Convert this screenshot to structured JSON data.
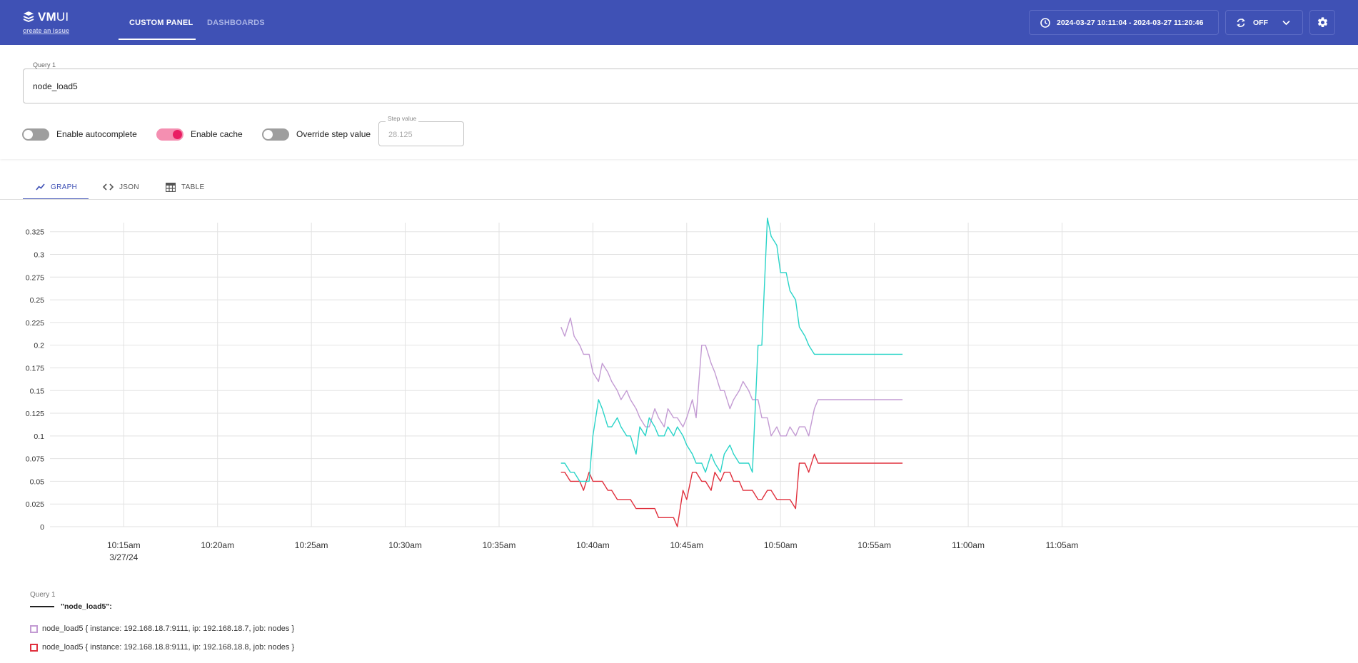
{
  "header": {
    "logo_main": "VM",
    "logo_suffix": "UI",
    "create_issue": "create an issue",
    "tabs": [
      {
        "label": "CUSTOM PANEL",
        "active": true
      },
      {
        "label": "DASHBOARDS",
        "active": false
      }
    ],
    "time_range": "2024-03-27 10:11:04 - 2024-03-27 11:20:46",
    "refresh_label": "OFF",
    "icons": {
      "time": "clock-icon",
      "refresh": "refresh-icon",
      "dropdown": "chevron-down-icon",
      "settings": "gear-icon"
    },
    "color": "#3f51b5"
  },
  "query": {
    "label": "Query 1",
    "value": "node_load5"
  },
  "options": {
    "autocomplete": {
      "label": "Enable autocomplete",
      "enabled": false
    },
    "cache": {
      "label": "Enable cache",
      "enabled": true
    },
    "override_step": {
      "label": "Override step value",
      "enabled": false
    },
    "step": {
      "label": "Step value",
      "placeholder": "28.125"
    }
  },
  "result_tabs": [
    {
      "label": "GRAPH",
      "icon": "chart-line-icon",
      "active": true
    },
    {
      "label": "JSON",
      "icon": "code-icon",
      "active": false
    },
    {
      "label": "TABLE",
      "icon": "table-icon",
      "active": false
    }
  ],
  "chart_data": {
    "type": "line",
    "x_ticks": [
      "10:15am",
      "10:20am",
      "10:25am",
      "10:30am",
      "10:35am",
      "10:40am",
      "10:45am",
      "10:50am",
      "10:55am",
      "11:00am",
      "11:05am"
    ],
    "x_date_label": "3/27/24",
    "y_ticks": [
      "0",
      "0.025",
      "0.05",
      "0.075",
      "0.1",
      "0.125",
      "0.15",
      "0.175",
      "0.2",
      "0.225",
      "0.25",
      "0.275",
      "0.3",
      "0.325"
    ],
    "ylim": [
      0,
      0.335
    ],
    "grid": true,
    "x_range_minutes": [
      11.07,
      80.77
    ],
    "series": [
      {
        "name": "node_load5{ instance: 192.168.18.7:9111, ip: 192.168.18.7, job: nodes }",
        "color": "#c39bd3",
        "x": [
          38.3,
          38.5,
          38.8,
          39.0,
          39.3,
          39.5,
          39.8,
          40.0,
          40.3,
          40.5,
          40.8,
          41.0,
          41.3,
          41.5,
          41.8,
          42.0,
          42.3,
          42.5,
          42.8,
          43.0,
          43.3,
          43.5,
          43.8,
          44.0,
          44.3,
          44.5,
          44.8,
          45.0,
          45.3,
          45.5,
          45.8,
          46.0,
          46.3,
          46.5,
          46.8,
          47.0,
          47.3,
          47.5,
          47.8,
          48.0,
          48.3,
          48.5,
          48.8,
          49.0,
          49.3,
          49.5,
          49.8,
          50.0,
          50.3,
          50.5,
          50.8,
          51.0,
          51.3,
          51.5,
          51.8,
          52.0,
          52.3,
          52.5,
          52.8,
          53.0,
          53.3,
          53.5,
          53.8,
          54.0,
          54.3,
          54.5,
          54.8,
          55.0,
          55.3,
          55.5,
          55.8,
          56.0,
          56.3,
          56.5
        ],
        "y": [
          0.22,
          0.21,
          0.23,
          0.21,
          0.2,
          0.19,
          0.19,
          0.17,
          0.16,
          0.18,
          0.17,
          0.16,
          0.15,
          0.14,
          0.15,
          0.14,
          0.13,
          0.12,
          0.11,
          0.11,
          0.13,
          0.12,
          0.11,
          0.13,
          0.12,
          0.12,
          0.11,
          0.12,
          0.14,
          0.12,
          0.2,
          0.2,
          0.18,
          0.17,
          0.15,
          0.15,
          0.13,
          0.14,
          0.15,
          0.16,
          0.15,
          0.14,
          0.14,
          0.12,
          0.12,
          0.1,
          0.11,
          0.1,
          0.1,
          0.11,
          0.1,
          0.11,
          0.11,
          0.1,
          0.13,
          0.14,
          0.14,
          0.14,
          0.14,
          0.14,
          0.14,
          0.14,
          0.14,
          0.14,
          0.14,
          0.14,
          0.14,
          0.14,
          0.14,
          0.14,
          0.14,
          0.14,
          0.14,
          0.14
        ]
      },
      {
        "name": "node_load5{ instance: 192.168.18.8:9111, ip: 192.168.18.8, job: nodes }",
        "color": "#e0303d",
        "x": [
          38.3,
          38.5,
          38.8,
          39.0,
          39.3,
          39.5,
          39.8,
          40.0,
          40.3,
          40.5,
          40.8,
          41.0,
          41.3,
          41.5,
          41.8,
          42.0,
          42.3,
          42.5,
          42.8,
          43.0,
          43.3,
          43.5,
          43.8,
          44.0,
          44.3,
          44.5,
          44.8,
          45.0,
          45.3,
          45.5,
          45.8,
          46.0,
          46.3,
          46.5,
          46.8,
          47.0,
          47.3,
          47.5,
          47.8,
          48.0,
          48.3,
          48.5,
          48.8,
          49.0,
          49.3,
          49.5,
          49.8,
          50.0,
          50.3,
          50.5,
          50.8,
          51.0,
          51.3,
          51.5,
          51.8,
          52.0,
          52.3,
          52.5,
          52.8,
          53.0,
          53.3,
          53.5,
          53.8,
          54.0,
          54.3,
          54.5,
          54.8,
          55.0,
          55.3,
          55.5,
          55.8,
          56.0,
          56.3,
          56.5
        ],
        "y": [
          0.06,
          0.06,
          0.05,
          0.05,
          0.05,
          0.04,
          0.06,
          0.05,
          0.05,
          0.05,
          0.04,
          0.04,
          0.03,
          0.03,
          0.03,
          0.03,
          0.02,
          0.02,
          0.02,
          0.02,
          0.02,
          0.01,
          0.01,
          0.01,
          0.01,
          0.0,
          0.04,
          0.03,
          0.06,
          0.06,
          0.05,
          0.05,
          0.04,
          0.06,
          0.05,
          0.06,
          0.06,
          0.05,
          0.05,
          0.04,
          0.04,
          0.04,
          0.03,
          0.03,
          0.04,
          0.04,
          0.03,
          0.03,
          0.03,
          0.03,
          0.02,
          0.07,
          0.07,
          0.06,
          0.08,
          0.07,
          0.07,
          0.07,
          0.07,
          0.07,
          0.07,
          0.07,
          0.07,
          0.07,
          0.07,
          0.07,
          0.07,
          0.07,
          0.07,
          0.07,
          0.07,
          0.07,
          0.07,
          0.07
        ]
      },
      {
        "name": "",
        "color": "#2ad4c8",
        "x": [
          38.3,
          38.5,
          38.8,
          39.0,
          39.3,
          39.5,
          39.8,
          40.0,
          40.3,
          40.5,
          40.8,
          41.0,
          41.3,
          41.5,
          41.8,
          42.0,
          42.3,
          42.5,
          42.8,
          43.0,
          43.3,
          43.5,
          43.8,
          44.0,
          44.3,
          44.5,
          44.8,
          45.0,
          45.3,
          45.5,
          45.8,
          46.0,
          46.3,
          46.5,
          46.8,
          47.0,
          47.3,
          47.5,
          47.8,
          48.0,
          48.3,
          48.5,
          48.8,
          49.0,
          49.3,
          49.5,
          49.8,
          50.0,
          50.3,
          50.5,
          50.8,
          51.0,
          51.3,
          51.5,
          51.8,
          52.0,
          52.3,
          52.5,
          52.8,
          53.0,
          53.3,
          53.5,
          53.8,
          54.0,
          54.3,
          54.5,
          54.8,
          55.0,
          55.3,
          55.5,
          55.8,
          56.0,
          56.3,
          56.5
        ],
        "y": [
          0.07,
          0.07,
          0.06,
          0.06,
          0.05,
          0.05,
          0.05,
          0.1,
          0.14,
          0.13,
          0.11,
          0.11,
          0.12,
          0.11,
          0.1,
          0.1,
          0.08,
          0.11,
          0.1,
          0.12,
          0.11,
          0.1,
          0.1,
          0.11,
          0.1,
          0.11,
          0.1,
          0.09,
          0.08,
          0.07,
          0.07,
          0.06,
          0.08,
          0.07,
          0.06,
          0.08,
          0.09,
          0.08,
          0.07,
          0.07,
          0.07,
          0.06,
          0.2,
          0.2,
          0.34,
          0.32,
          0.31,
          0.28,
          0.28,
          0.26,
          0.25,
          0.22,
          0.21,
          0.2,
          0.19,
          0.19,
          0.19,
          0.19,
          0.19,
          0.19,
          0.19,
          0.19,
          0.19,
          0.19,
          0.19,
          0.19,
          0.19,
          0.19,
          0.19,
          0.19,
          0.19,
          0.19,
          0.19,
          0.19
        ]
      }
    ]
  },
  "legend": {
    "query_label": "Query 1",
    "title": "\"node_load5\":",
    "items": [
      {
        "text": "node_load5 { instance: 192.168.18.7:9111,  ip: 192.168.18.7,  job: nodes }",
        "color": "#c39bd3"
      },
      {
        "text": "node_load5 { instance: 192.168.18.8:9111,  ip: 192.168.18.8,  job: nodes }",
        "color": "#e0303d"
      }
    ]
  }
}
